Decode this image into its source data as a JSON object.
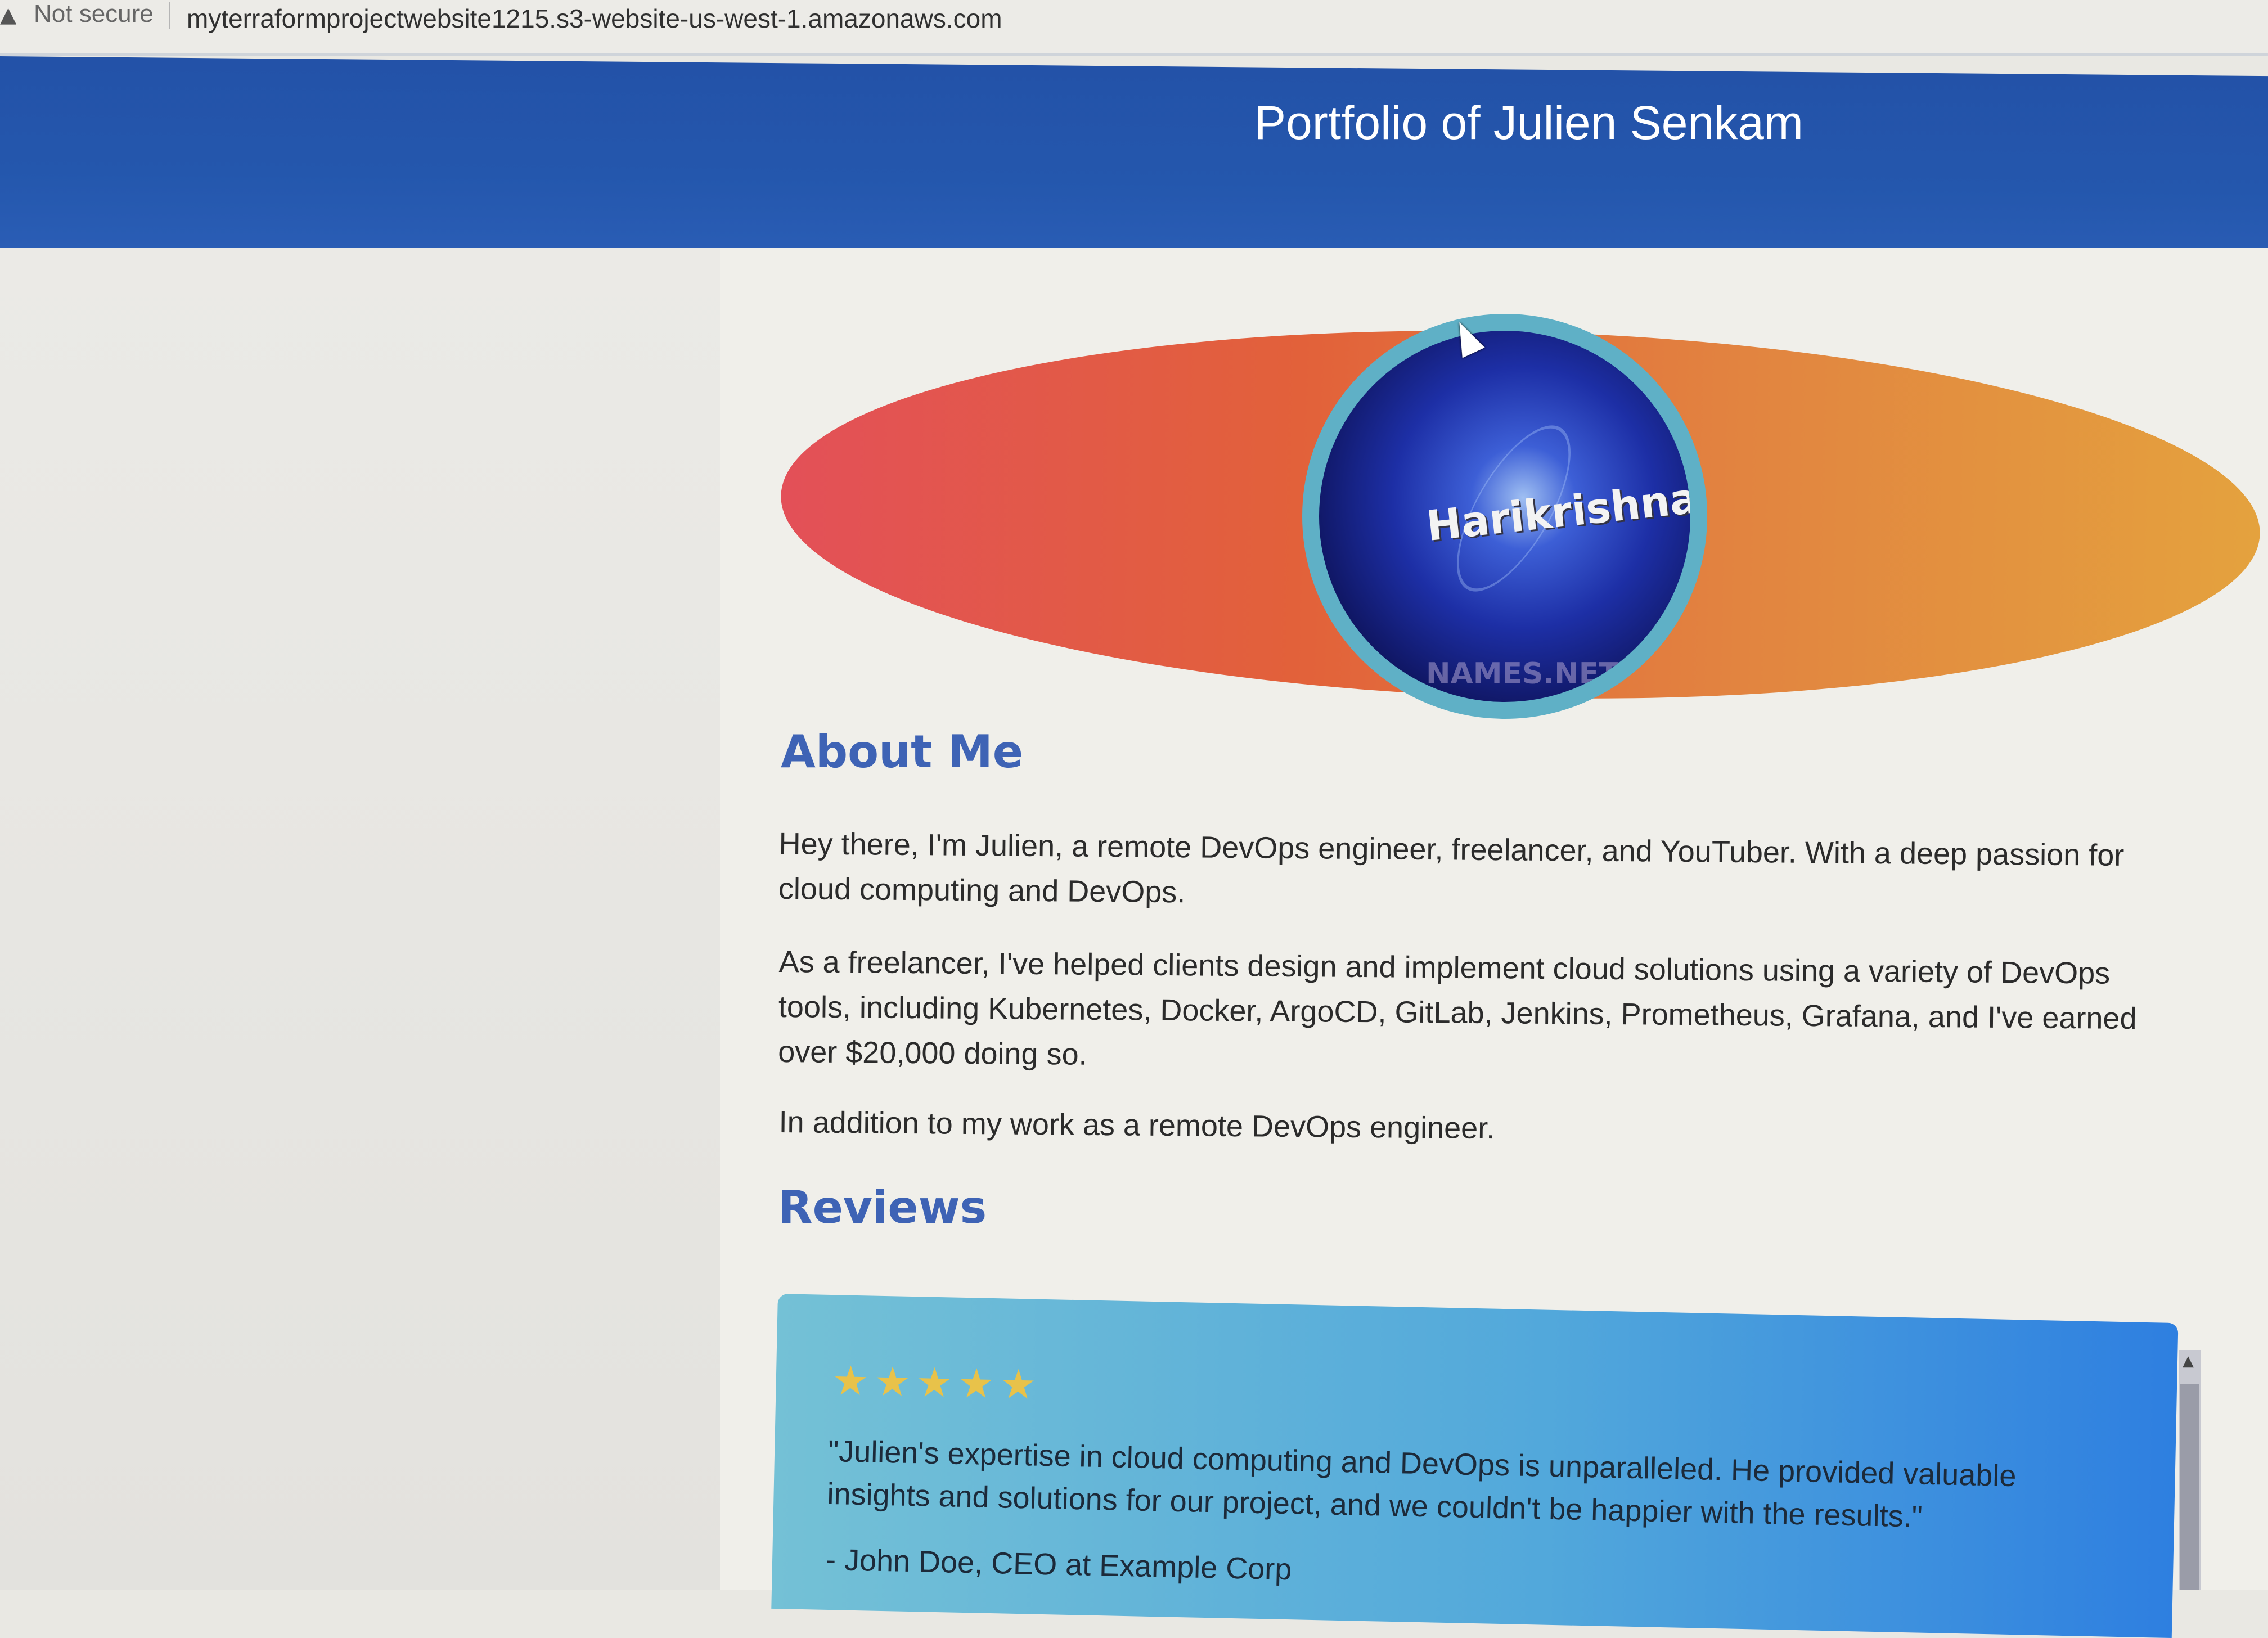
{
  "browser": {
    "security_icon": "warning-triangle-icon",
    "security_label": "Not secure",
    "url": "myterraformprojectwebsite1215.s3-website-us-west-1.amazonaws.com"
  },
  "header": {
    "title": "Portfolio of Julien Senkam",
    "background_color": "#2457ad"
  },
  "hero": {
    "avatar_text": "Harikrishna",
    "avatar_watermark": "NAMES.NET",
    "ellipse_colors": [
      "#e35058",
      "#e4a23e"
    ],
    "avatar_ring_color": "#5fb0c6"
  },
  "about": {
    "heading": "About Me",
    "paragraphs": [
      "Hey there, I'm Julien, a remote DevOps engineer, freelancer, and YouTuber. With a deep passion for cloud computing and DevOps.",
      "As a freelancer, I've helped clients design and implement cloud solutions using a variety of DevOps tools, including Kubernetes, Docker, ArgoCD, GitLab, Jenkins, Prometheus, Grafana, and I've earned over $20,000 doing so.",
      "In addition to my work as a remote DevOps engineer."
    ]
  },
  "reviews": {
    "heading": "Reviews",
    "items": [
      {
        "rating": 5,
        "stars": "★★★★★",
        "text": "\"Julien's expertise in cloud computing and DevOps is unparalleled. He provided valuable insights and solutions for our project, and we couldn't be happier with the results.\"",
        "author": "- John Doe, CEO at Example Corp"
      }
    ]
  },
  "colors": {
    "heading": "#3e63b5",
    "review_card_start": "#74c1d6",
    "review_card_end": "#2e7fe0",
    "star": "#e8c24a"
  }
}
